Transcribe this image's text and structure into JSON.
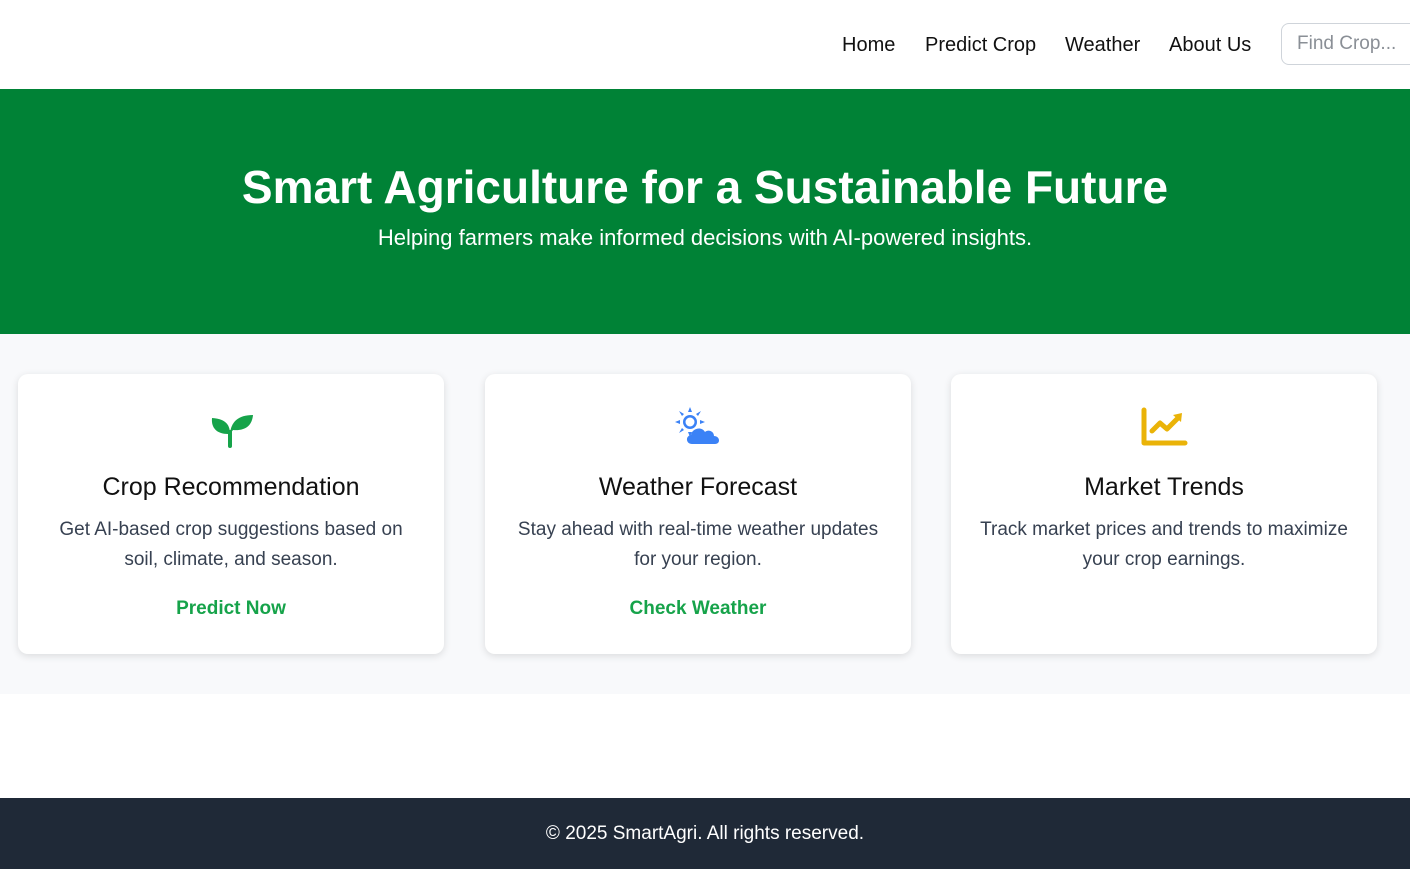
{
  "nav": {
    "links": [
      "Home",
      "Predict Crop",
      "Weather",
      "About Us"
    ],
    "search_placeholder": "Find Crop..."
  },
  "hero": {
    "title": "Smart Agriculture for a Sustainable Future",
    "subtitle": "Helping farmers make informed decisions with AI-powered insights."
  },
  "features": [
    {
      "icon": "seedling-icon",
      "icon_color": "#16a34a",
      "title": "Crop Recommendation",
      "description": "Get AI-based crop suggestions based on soil, climate, and season.",
      "link": "Predict Now"
    },
    {
      "icon": "sun-cloud-icon",
      "icon_color": "#3b82f6",
      "title": "Weather Forecast",
      "description": "Stay ahead with real-time weather updates for your region.",
      "link": "Check Weather"
    },
    {
      "icon": "chart-line-icon",
      "icon_color": "#eab308",
      "title": "Market Trends",
      "description": "Track market prices and trends to maximize your crop earnings.",
      "link": ""
    }
  ],
  "footer": {
    "text": "© 2025 SmartAgri. All rights reserved."
  },
  "colors": {
    "hero_bg": "#008236",
    "footer_bg": "#1f2937",
    "link_green": "#16a34a"
  }
}
